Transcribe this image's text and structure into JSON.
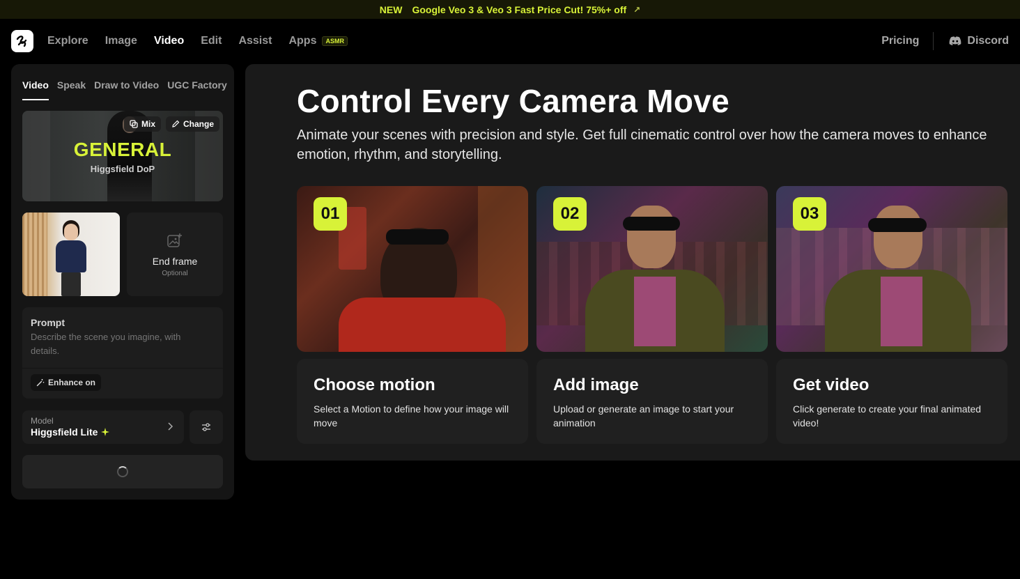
{
  "announcement": {
    "tag": "NEW",
    "message": "Google Veo 3 & Veo 3 Fast Price Cut! 75%+ off",
    "arrow": "↗"
  },
  "nav": {
    "items": [
      {
        "label": "Explore",
        "active": false
      },
      {
        "label": "Image",
        "active": false
      },
      {
        "label": "Video",
        "active": true
      },
      {
        "label": "Edit",
        "active": false
      },
      {
        "label": "Assist",
        "active": false
      },
      {
        "label": "Apps",
        "active": false
      }
    ],
    "apps_badge": "ASMR",
    "pricing": "Pricing",
    "discord": "Discord"
  },
  "panel": {
    "tabs": [
      "Video",
      "Speak",
      "Draw to Video",
      "UGC Factory"
    ],
    "motion": {
      "title": "GENERAL",
      "subtitle": "Higgsfield DoP",
      "mix_label": "Mix",
      "change_label": "Change"
    },
    "end_frame": {
      "label": "End frame",
      "sub": "Optional"
    },
    "prompt": {
      "label": "Prompt",
      "placeholder": "Describe the scene you imagine, with details.",
      "enhance_label": "Enhance on"
    },
    "model": {
      "label": "Model",
      "value": "Higgsfield Lite"
    }
  },
  "main": {
    "title": "Control Every Camera Move",
    "lead": "Animate your scenes with precision and style. Get full cinematic control over how the camera moves to enhance emotion, rhythm, and storytelling.",
    "steps": [
      {
        "num": "01",
        "title": "Choose motion",
        "desc": "Select a Motion to define how your image will move"
      },
      {
        "num": "02",
        "title": "Add image",
        "desc": "Upload or generate an image to start your animation"
      },
      {
        "num": "03",
        "title": "Get video",
        "desc": "Click generate to create your final animated video!"
      }
    ]
  },
  "colors": {
    "accent": "#d8f238",
    "panel": "#151515",
    "card": "#1d1d1d"
  }
}
